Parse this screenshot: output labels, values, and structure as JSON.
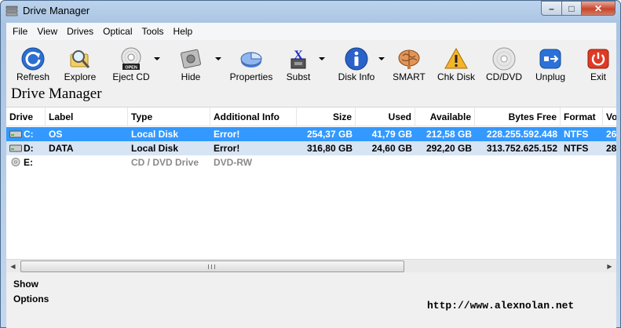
{
  "window": {
    "title": "Drive Manager",
    "min": "–",
    "max": "□",
    "close": "✕"
  },
  "menu": [
    "File",
    "View",
    "Drives",
    "Optical",
    "Tools",
    "Help"
  ],
  "toolbar": {
    "refresh": "Refresh",
    "explore": "Explore",
    "eject": "Eject CD",
    "eject_badge": "OPEN",
    "hide": "Hide",
    "properties": "Properties",
    "subst": "Subst",
    "diskinfo": "Disk Info",
    "smart": "SMART",
    "chkdisk": "Chk Disk",
    "cddvd": "CD/DVD",
    "unplug": "Unplug",
    "exit": "Exit"
  },
  "heading": "Drive Manager",
  "columns": [
    "Drive",
    "Label",
    "Type",
    "Additional Info",
    "Size",
    "Used",
    "Available",
    "Bytes Free",
    "Format",
    "Vo"
  ],
  "rows": [
    {
      "drive": "C:",
      "label": "OS",
      "type": "Local Disk",
      "info": "Error!",
      "size": "254,37 GB",
      "used": "41,79 GB",
      "avail": "212,58 GB",
      "free": "228.255.592.448",
      "format": "NTFS",
      "vo": "26"
    },
    {
      "drive": "D:",
      "label": "DATA",
      "type": "Local Disk",
      "info": "Error!",
      "size": "316,80 GB",
      "used": "24,60 GB",
      "avail": "292,20 GB",
      "free": "313.752.625.152",
      "format": "NTFS",
      "vo": "28"
    },
    {
      "drive": "E:",
      "label": "",
      "type": "CD / DVD Drive",
      "info": "DVD-RW",
      "size": "",
      "used": "",
      "avail": "",
      "free": "",
      "format": "",
      "vo": ""
    }
  ],
  "bottom": {
    "show": "Show",
    "options": "Options",
    "url": "http://www.alexnolan.net"
  },
  "colors": {
    "selection": "#3399ff",
    "alt_row": "#d7e4f4",
    "close_btn": "#c7462c"
  }
}
